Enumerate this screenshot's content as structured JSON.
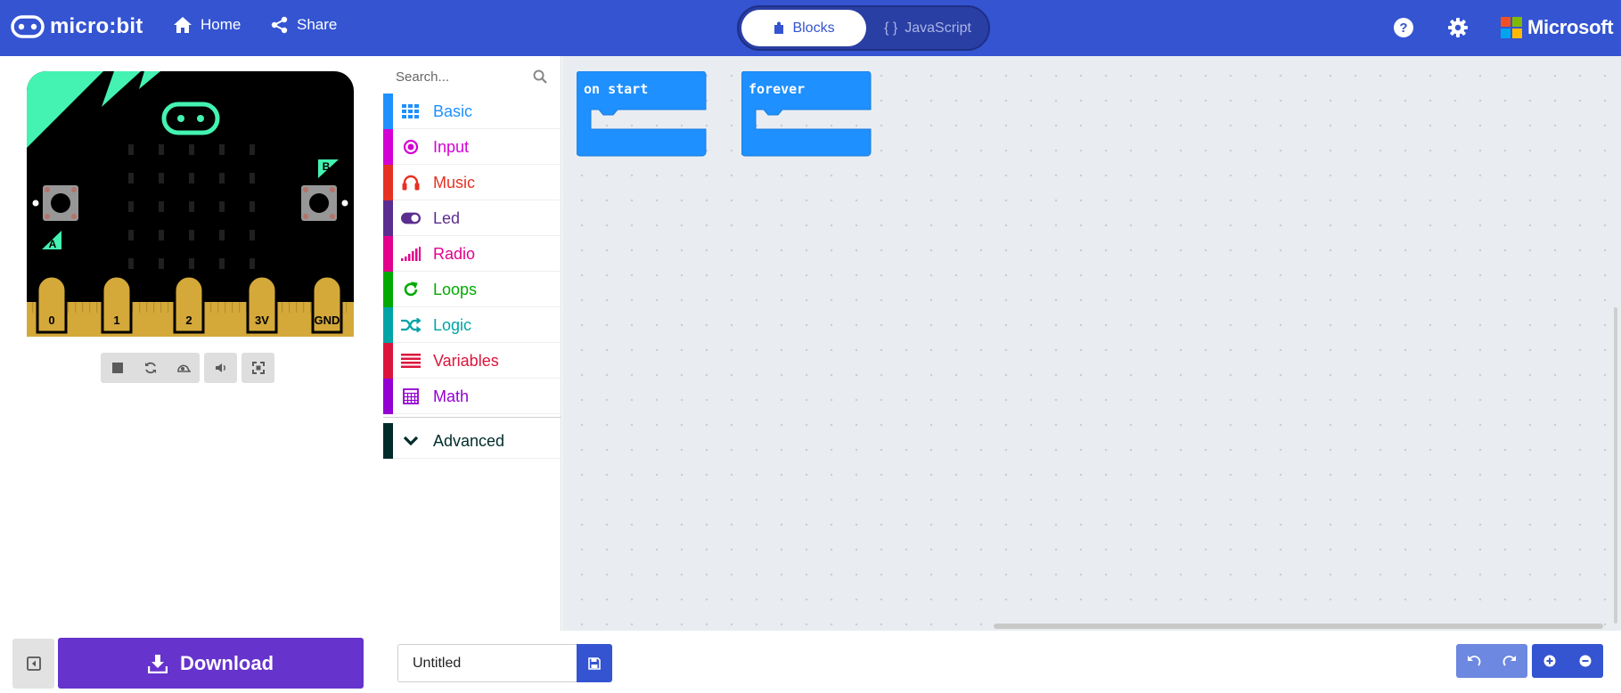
{
  "app": {
    "logo_text": "micro:bit",
    "brand_color": "#3454d1"
  },
  "topbar": {
    "home_label": "Home",
    "share_label": "Share",
    "mode_blocks_label": "Blocks",
    "mode_js_label": "JavaScript",
    "mode_js_glyph": "{ }",
    "microsoft_label": "Microsoft",
    "icons": {
      "logo": "microbit-logo-icon",
      "home": "home-icon",
      "share": "share-icon",
      "blocks": "puzzle-piece-icon",
      "help": "help-icon",
      "settings": "gear-icon",
      "microsoft": "microsoft-logo-icon"
    }
  },
  "simulator": {
    "button_a": "A",
    "button_b": "B",
    "pins": [
      "0",
      "1",
      "2",
      "3V",
      "GND"
    ],
    "controls": [
      "stop-icon",
      "restart-icon",
      "slow-motion-icon",
      "mute-icon",
      "fullscreen-icon"
    ]
  },
  "toolbox": {
    "search_placeholder": "Search...",
    "categories": [
      {
        "label": "Basic",
        "color": "#1e90ff",
        "icon": "grid-icon"
      },
      {
        "label": "Input",
        "color": "#d400d4",
        "icon": "radio-button-icon"
      },
      {
        "label": "Music",
        "color": "#e63022",
        "icon": "headphones-icon"
      },
      {
        "label": "Led",
        "color": "#5c2d91",
        "icon": "toggle-icon"
      },
      {
        "label": "Radio",
        "color": "#e3008c",
        "icon": "signal-bars-icon"
      },
      {
        "label": "Loops",
        "color": "#00aa00",
        "icon": "refresh-icon"
      },
      {
        "label": "Logic",
        "color": "#00a4a6",
        "icon": "shuffle-icon"
      },
      {
        "label": "Variables",
        "color": "#dc143c",
        "icon": "list-lines-icon"
      },
      {
        "label": "Math",
        "color": "#9400d3",
        "icon": "calculator-icon"
      }
    ],
    "advanced": {
      "label": "Advanced",
      "color": "#002b2b",
      "icon": "chevron-down-icon"
    }
  },
  "workspace": {
    "blocks": [
      {
        "label": "on start",
        "color": "#1e90ff"
      },
      {
        "label": "forever",
        "color": "#1e90ff"
      }
    ]
  },
  "bottombar": {
    "download_label": "Download",
    "download_color": "#6633cc",
    "project_name": "Untitled",
    "icons": {
      "collapse": "collapse-simulator-icon",
      "download": "download-icon",
      "save": "save-icon",
      "undo": "undo-icon",
      "redo": "redo-icon",
      "zoom_in": "zoom-in-icon",
      "zoom_out": "zoom-out-icon"
    }
  }
}
